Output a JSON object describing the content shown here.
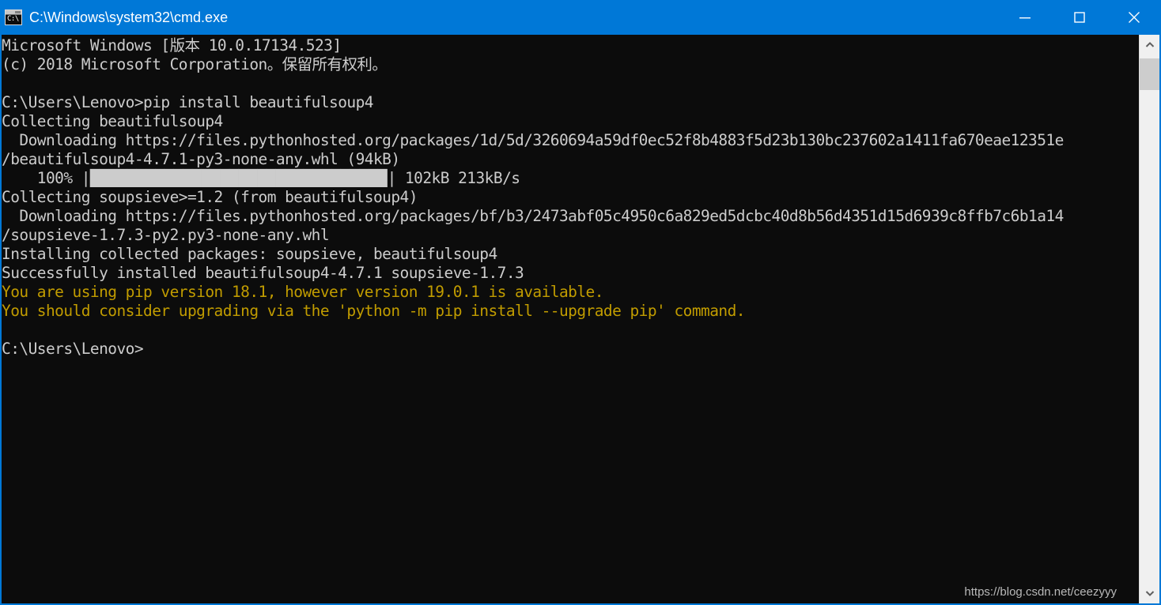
{
  "window": {
    "title": "C:\\Windows\\system32\\cmd.exe",
    "icon": "cmd-icon",
    "icon_text": "C:\\",
    "accent_color": "#0078d7",
    "background_color": "#0c0c0c",
    "foreground_color": "#cccccc",
    "warning_color": "#c19c00",
    "controls": [
      {
        "name": "minimize",
        "glyph": "minimize-icon"
      },
      {
        "name": "maximize",
        "glyph": "maximize-icon"
      },
      {
        "name": "close",
        "glyph": "close-icon"
      }
    ]
  },
  "console": {
    "lines": [
      {
        "text": "Microsoft Windows [版本 10.0.17134.523]",
        "color": "normal"
      },
      {
        "text": "(c) 2018 Microsoft Corporation。保留所有权利。",
        "color": "normal"
      },
      {
        "text": "",
        "color": "normal"
      },
      {
        "text": "C:\\Users\\Lenovo>pip install beautifulsoup4",
        "color": "normal"
      },
      {
        "text": "Collecting beautifulsoup4",
        "color": "normal"
      },
      {
        "text": "  Downloading https://files.pythonhosted.org/packages/1d/5d/3260694a59df0ec52f8b4883f5d23b130bc237602a1411fa670eae12351e",
        "color": "normal"
      },
      {
        "text": "/beautifulsoup4-4.7.1-py3-none-any.whl (94kB)",
        "color": "normal"
      },
      {
        "text": "    100% |████████████████████████████████| 102kB 213kB/s",
        "color": "normal"
      },
      {
        "text": "Collecting soupsieve>=1.2 (from beautifulsoup4)",
        "color": "normal"
      },
      {
        "text": "  Downloading https://files.pythonhosted.org/packages/bf/b3/2473abf05c4950c6a829ed5dcbc40d8b56d4351d15d6939c8ffb7c6b1a14",
        "color": "normal"
      },
      {
        "text": "/soupsieve-1.7.3-py2.py3-none-any.whl",
        "color": "normal"
      },
      {
        "text": "Installing collected packages: soupsieve, beautifulsoup4",
        "color": "normal"
      },
      {
        "text": "Successfully installed beautifulsoup4-4.7.1 soupsieve-1.7.3",
        "color": "normal"
      },
      {
        "text": "You are using pip version 18.1, however version 19.0.1 is available.",
        "color": "yellow"
      },
      {
        "text": "You should consider upgrading via the 'python -m pip install --upgrade pip' command.",
        "color": "yellow"
      },
      {
        "text": "",
        "color": "normal"
      },
      {
        "text": "C:\\Users\\Lenovo>",
        "color": "normal"
      }
    ]
  },
  "scrollbar": {
    "up_arrow": "chevron-up-icon",
    "down_arrow": "chevron-down-icon"
  },
  "watermark": {
    "text": "https://blog.csdn.net/ceezyyy"
  }
}
